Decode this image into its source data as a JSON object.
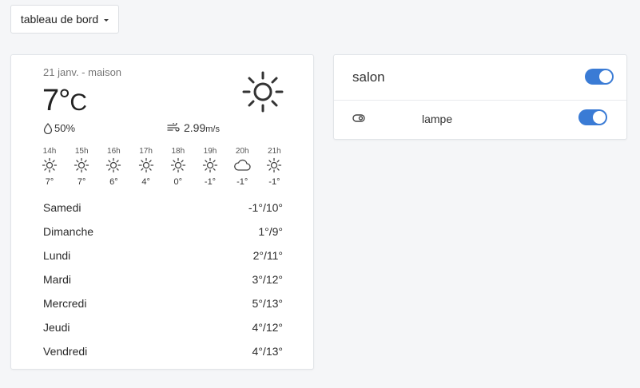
{
  "header": {
    "dashboard_label": "tableau de bord"
  },
  "weather": {
    "date_location": "21 janv. - maison",
    "temperature": "7°",
    "unit": "C",
    "humidity": "50%",
    "wind_speed": "2.99",
    "wind_unit": "m/s",
    "current_icon": "sun-icon",
    "hourly": [
      {
        "time": "14h",
        "icon": "sun",
        "temp": "7°"
      },
      {
        "time": "15h",
        "icon": "sun",
        "temp": "7°"
      },
      {
        "time": "16h",
        "icon": "sun",
        "temp": "6°"
      },
      {
        "time": "17h",
        "icon": "sun",
        "temp": "4°"
      },
      {
        "time": "18h",
        "icon": "sun",
        "temp": "0°"
      },
      {
        "time": "19h",
        "icon": "sun",
        "temp": "-1°"
      },
      {
        "time": "20h",
        "icon": "cloud",
        "temp": "-1°"
      },
      {
        "time": "21h",
        "icon": "sun",
        "temp": "-1°"
      }
    ],
    "daily": [
      {
        "day": "Samedi",
        "range": "-1°/10°"
      },
      {
        "day": "Dimanche",
        "range": "1°/9°"
      },
      {
        "day": "Lundi",
        "range": "2°/11°"
      },
      {
        "day": "Mardi",
        "range": "3°/12°"
      },
      {
        "day": "Mercredi",
        "range": "5°/13°"
      },
      {
        "day": "Jeudi",
        "range": "4°/12°"
      },
      {
        "day": "Vendredi",
        "range": "4°/13°"
      }
    ]
  },
  "room": {
    "name": "salon",
    "toggle_on": true,
    "devices": [
      {
        "label": "lampe",
        "icon": "toggle-switch-icon",
        "on": true
      }
    ]
  },
  "colors": {
    "accent": "#3a7bd5",
    "background": "#f5f6f8"
  }
}
